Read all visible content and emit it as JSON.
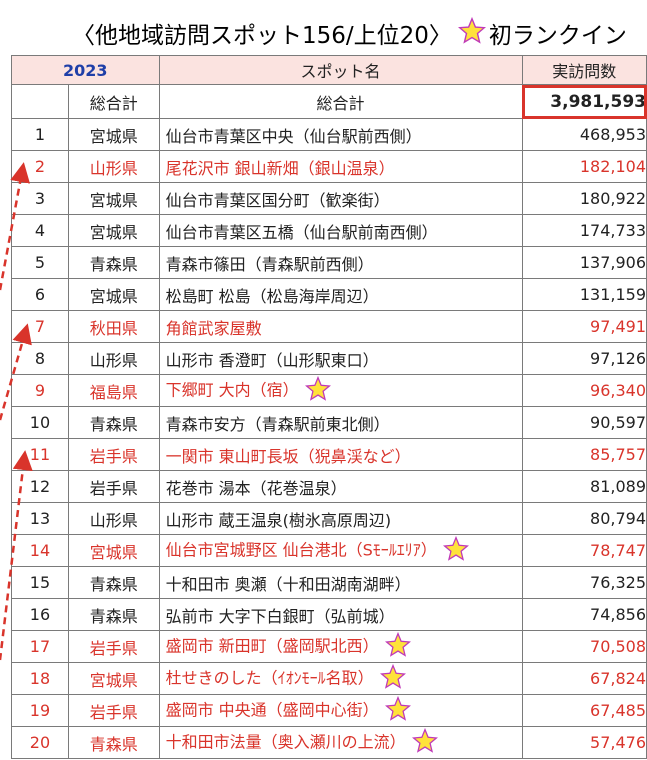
{
  "title": {
    "text": "〈他地域訪問スポット156/上位20〉",
    "legend": "初ランクイン"
  },
  "header": {
    "year": "2023",
    "spot_col": "スポット名",
    "visits_col": "実訪問数"
  },
  "total": {
    "num": "",
    "pref": "総合計",
    "spot": "総合計",
    "value": "3,981,593"
  },
  "rows": [
    {
      "rank": "1",
      "pref": "宮城県",
      "spot": "仙台市青葉区中央（仙台駅前西側）",
      "value": "468,953",
      "highlight": false,
      "new": false
    },
    {
      "rank": "2",
      "pref": "山形県",
      "spot": "尾花沢市 銀山新畑（銀山温泉）",
      "value": "182,104",
      "highlight": true,
      "new": false
    },
    {
      "rank": "3",
      "pref": "宮城県",
      "spot": "仙台市青葉区国分町（歓楽街）",
      "value": "180,922",
      "highlight": false,
      "new": false
    },
    {
      "rank": "4",
      "pref": "宮城県",
      "spot": "仙台市青葉区五橋（仙台駅前南西側）",
      "value": "174,733",
      "highlight": false,
      "new": false
    },
    {
      "rank": "5",
      "pref": "青森県",
      "spot": "青森市篠田（青森駅前西側）",
      "value": "137,906",
      "highlight": false,
      "new": false
    },
    {
      "rank": "6",
      "pref": "宮城県",
      "spot": "松島町 松島（松島海岸周辺）",
      "value": "131,159",
      "highlight": false,
      "new": false
    },
    {
      "rank": "7",
      "pref": "秋田県",
      "spot": "角館武家屋敷",
      "value": "97,491",
      "highlight": true,
      "new": false
    },
    {
      "rank": "8",
      "pref": "山形県",
      "spot": "山形市 香澄町（山形駅東口）",
      "value": "97,126",
      "highlight": false,
      "new": false
    },
    {
      "rank": "9",
      "pref": "福島県",
      "spot": "下郷町 大内（宿）",
      "value": "96,340",
      "highlight": true,
      "new": true
    },
    {
      "rank": "10",
      "pref": "青森県",
      "spot": "青森市安方（青森駅前東北側）",
      "value": "90,597",
      "highlight": false,
      "new": false
    },
    {
      "rank": "11",
      "pref": "岩手県",
      "spot": "一関市 東山町長坂（猊鼻渓など）",
      "value": "85,757",
      "highlight": true,
      "new": false
    },
    {
      "rank": "12",
      "pref": "岩手県",
      "spot": "花巻市 湯本（花巻温泉）",
      "value": "81,089",
      "highlight": false,
      "new": false
    },
    {
      "rank": "13",
      "pref": "山形県",
      "spot": "山形市 蔵王温泉(樹氷高原周辺)",
      "value": "80,794",
      "highlight": false,
      "new": false
    },
    {
      "rank": "14",
      "pref": "宮城県",
      "spot": "仙台市宮城野区 仙台港北（Sﾓｰﾙｴﾘｱ）",
      "value": "78,747",
      "highlight": true,
      "new": true
    },
    {
      "rank": "15",
      "pref": "青森県",
      "spot": "十和田市 奥瀬（十和田湖南湖畔）",
      "value": "76,325",
      "highlight": false,
      "new": false
    },
    {
      "rank": "16",
      "pref": "青森県",
      "spot": "弘前市 大字下白銀町（弘前城）",
      "value": "74,856",
      "highlight": false,
      "new": false
    },
    {
      "rank": "17",
      "pref": "岩手県",
      "spot": "盛岡市 新田町（盛岡駅北西）",
      "value": "70,508",
      "highlight": true,
      "new": true
    },
    {
      "rank": "18",
      "pref": "宮城県",
      "spot": "杜せきのした（ｲｵﾝﾓｰﾙ名取）",
      "value": "67,824",
      "highlight": true,
      "new": true
    },
    {
      "rank": "19",
      "pref": "岩手県",
      "spot": "盛岡市 中央通（盛岡中心街）",
      "value": "67,485",
      "highlight": true,
      "new": true
    },
    {
      "rank": "20",
      "pref": "青森県",
      "spot": "十和田市法量（奥入瀬川の上流）",
      "value": "57,476",
      "highlight": true,
      "new": true
    }
  ],
  "colors": {
    "header_bg": "#fbe3e0",
    "year": "#1f3fa8",
    "highlight_text": "#d9342b",
    "star_fill": "#ffe23a",
    "star_stroke": "#c03ab8",
    "arrow": "#d9342b"
  }
}
